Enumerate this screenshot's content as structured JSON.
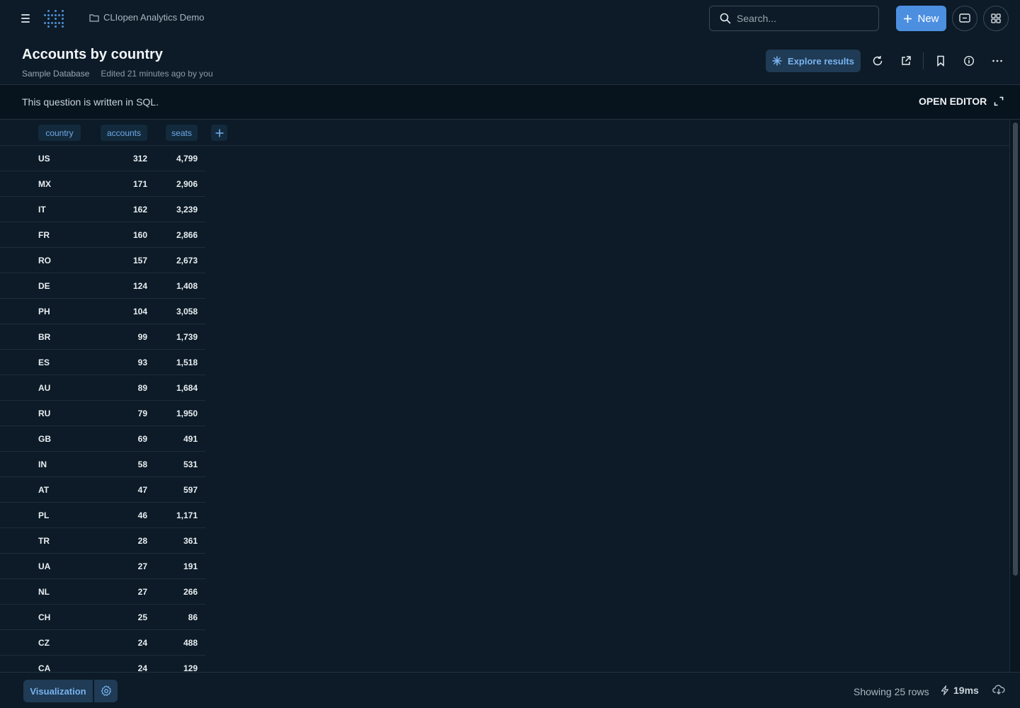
{
  "topbar": {
    "collection_name": "CLIopen Analytics Demo",
    "search_placeholder": "Search...",
    "new_label": "New"
  },
  "question": {
    "title": "Accounts by country",
    "database": "Sample Database",
    "edited": "Edited 21 minutes ago by you",
    "explore_label": "Explore results"
  },
  "sql_bar": {
    "message": "This question is written in SQL.",
    "open_editor_label": "OPEN EDITOR"
  },
  "table": {
    "columns": [
      "country",
      "accounts",
      "seats"
    ],
    "rows": [
      [
        "US",
        "312",
        "4,799"
      ],
      [
        "MX",
        "171",
        "2,906"
      ],
      [
        "IT",
        "162",
        "3,239"
      ],
      [
        "FR",
        "160",
        "2,866"
      ],
      [
        "RO",
        "157",
        "2,673"
      ],
      [
        "DE",
        "124",
        "1,408"
      ],
      [
        "PH",
        "104",
        "3,058"
      ],
      [
        "BR",
        "99",
        "1,739"
      ],
      [
        "ES",
        "93",
        "1,518"
      ],
      [
        "AU",
        "89",
        "1,684"
      ],
      [
        "RU",
        "79",
        "1,950"
      ],
      [
        "GB",
        "69",
        "491"
      ],
      [
        "IN",
        "58",
        "531"
      ],
      [
        "AT",
        "47",
        "597"
      ],
      [
        "PL",
        "46",
        "1,171"
      ],
      [
        "TR",
        "28",
        "361"
      ],
      [
        "UA",
        "27",
        "191"
      ],
      [
        "NL",
        "27",
        "266"
      ],
      [
        "CH",
        "25",
        "86"
      ],
      [
        "CZ",
        "24",
        "488"
      ],
      [
        "CA",
        "24",
        "129"
      ]
    ]
  },
  "footer": {
    "visualization_label": "Visualization",
    "row_count": "Showing 25 rows",
    "timing": "19ms"
  },
  "colors": {
    "background": "#0c1b27",
    "accent": "#4c8fe0",
    "accent_text": "#79b3f0"
  }
}
